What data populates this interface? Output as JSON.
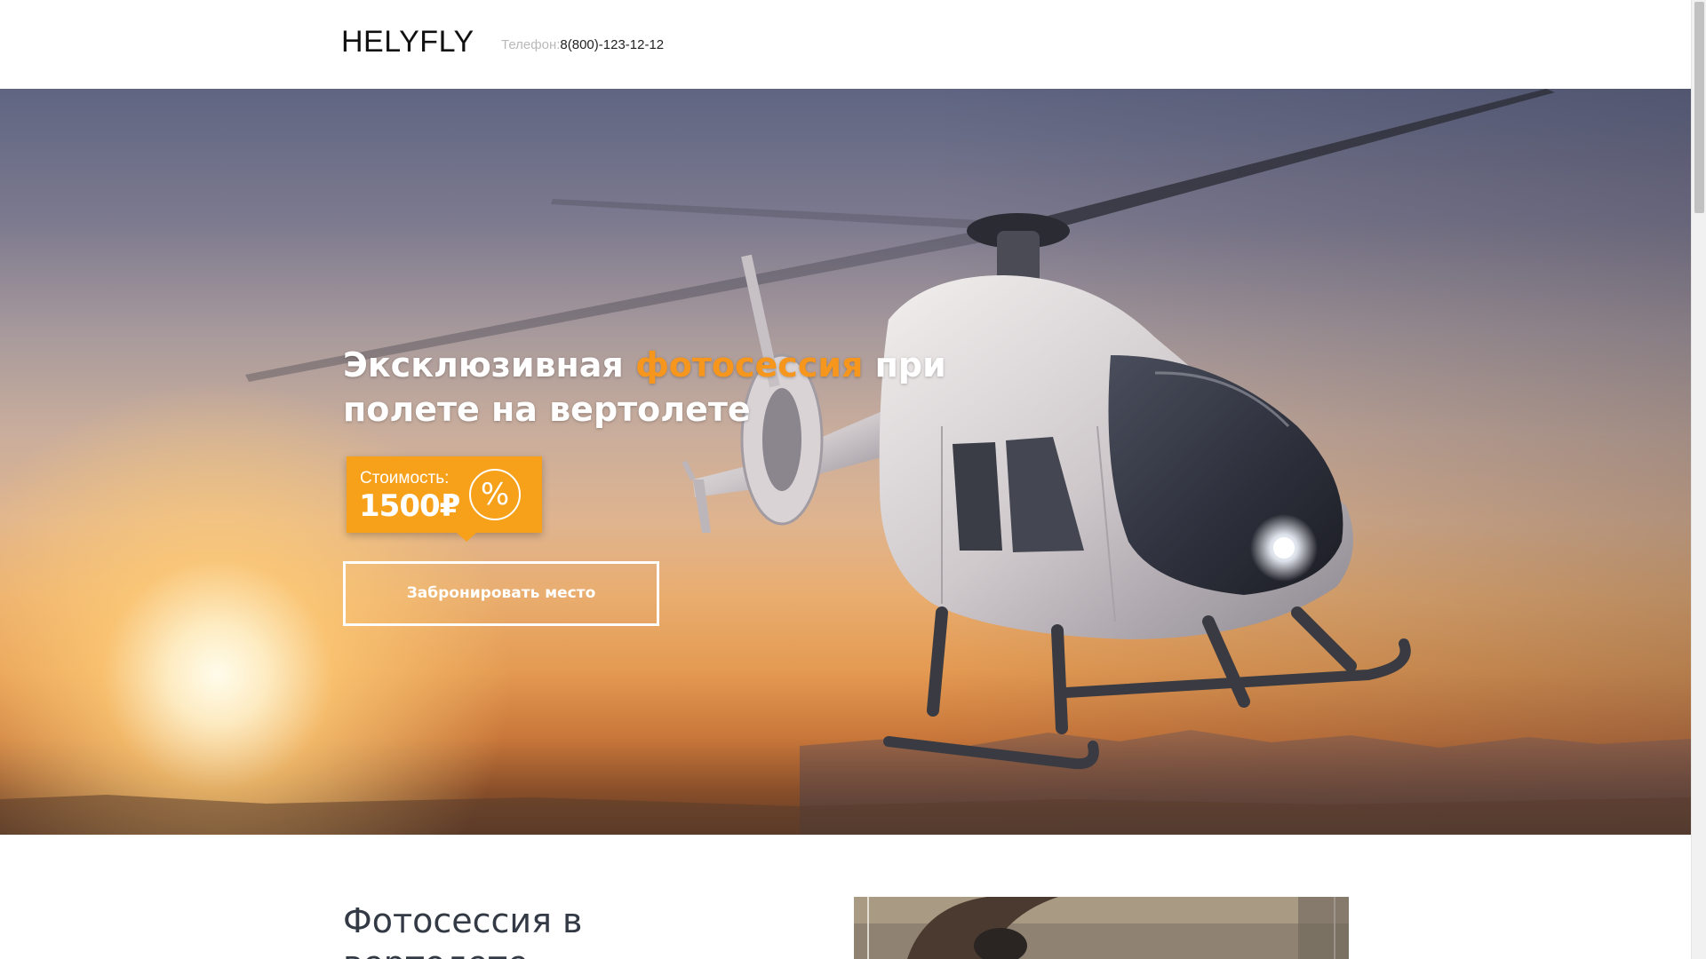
{
  "header": {
    "logo": "HELYFLY",
    "phone_label": "Телефон:",
    "phone_number": "8(800)-123-12-12"
  },
  "hero": {
    "title_part1": "Эксклюзивная ",
    "title_accent": "фотосессия",
    "title_part2": " при полете на вертолете",
    "price_label": "Стоимость:",
    "price_value": "1500₽",
    "percent_symbol": "%",
    "book_button": "Забронировать место",
    "image_icon": "helicopter-at-sunset-image"
  },
  "section2": {
    "title": "Фотосессия в вертолете",
    "photo_icon": "person-with-headphones-over-city-photo"
  },
  "colors": {
    "accent": "#f7961d",
    "badge": "#f7a11a",
    "text_dark": "#333a45"
  }
}
